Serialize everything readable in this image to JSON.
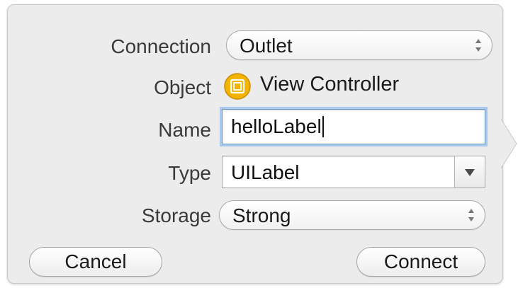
{
  "dialog": {
    "connection": {
      "label": "Connection",
      "value": "Outlet"
    },
    "object": {
      "label": "Object",
      "value": "View Controller",
      "icon": "view-controller-icon",
      "icon_color": "#f2b400"
    },
    "name": {
      "label": "Name",
      "value": "helloLabel"
    },
    "type": {
      "label": "Type",
      "value": "UILabel"
    },
    "storage": {
      "label": "Storage",
      "value": "Strong"
    },
    "buttons": {
      "cancel": "Cancel",
      "connect": "Connect"
    }
  },
  "colors": {
    "panel_bg": "#ececec",
    "focus_ring": "#a9c8ea"
  }
}
